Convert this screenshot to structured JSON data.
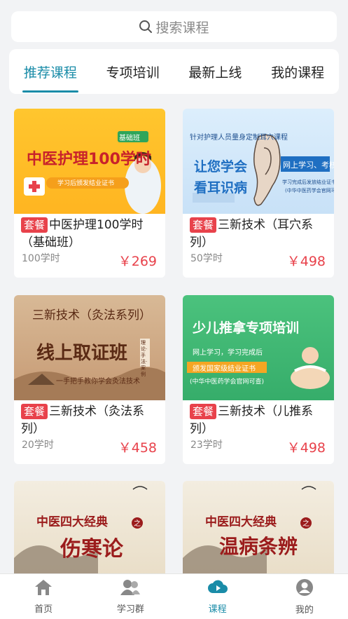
{
  "search": {
    "placeholder": "搜索课程"
  },
  "tabs": [
    {
      "label": "推荐课程",
      "active": true
    },
    {
      "label": "专项培训",
      "active": false
    },
    {
      "label": "最新上线",
      "active": false
    },
    {
      "label": "我的课程",
      "active": false
    }
  ],
  "courses": [
    {
      "tag": "套餐",
      "title": "中医护理100学时（基础班）",
      "hours": "100学时",
      "price": "￥269",
      "thumb": {
        "badge": "基础班",
        "headline": "中医护理100学时",
        "sub": "学习后颁发结业证书"
      }
    },
    {
      "tag": "套餐",
      "title": "三新技术（耳穴系列）",
      "hours": "50学时",
      "price": "￥498",
      "thumb": {
        "top": "针对护理人员量身定制耳穴课程",
        "line1": "让您学会",
        "line2": "看耳识病",
        "box": "网上学习、考核",
        "note1": "学习完成后发放结业证书",
        "note2": "(中华中医药学会官网可查)"
      }
    },
    {
      "tag": "套餐",
      "title": "三新技术（灸法系列）",
      "hours": "20学时",
      "price": "￥458",
      "thumb": {
        "line1": "三新技术（灸法系列）",
        "line2": "线上取证班",
        "line3": "一手把手教你学会灸法技术",
        "side": "理论·手法·案例"
      }
    },
    {
      "tag": "套餐",
      "title": "三新技术（儿推系列）",
      "hours": "23学时",
      "price": "￥498",
      "thumb": {
        "headline": "少儿推拿专项培训",
        "line1": "网上学习，学习完成后",
        "line2": "颁发国家级结业证书",
        "line3": "(中华中医药学会官网可查)"
      }
    },
    {
      "thumb": {
        "line1": "中医四大经典",
        "badge": "之",
        "line2": "伤寒论"
      }
    },
    {
      "thumb": {
        "line1": "中医四大经典",
        "badge": "之",
        "line2": "温病条辨"
      }
    }
  ],
  "nav": [
    {
      "label": "首页",
      "icon": "home-icon",
      "active": false
    },
    {
      "label": "学习群",
      "icon": "group-icon",
      "active": false
    },
    {
      "label": "课程",
      "icon": "course-play-icon",
      "active": true
    },
    {
      "label": "我的",
      "icon": "profile-icon",
      "active": false
    }
  ],
  "colors": {
    "accent": "#1a8ca8",
    "price": "#e8424b",
    "background": "#f2f3f5"
  }
}
